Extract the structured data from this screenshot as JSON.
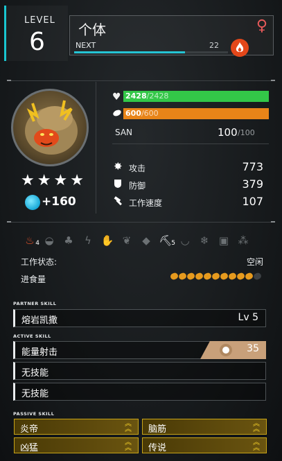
{
  "header": {
    "level_label": "LEVEL",
    "level_value": "6",
    "name": "个体",
    "gender_symbol": "♀",
    "next_label": "NEXT",
    "next_value": "22",
    "xp_progress_percent": 72,
    "element_icon": "fire-icon"
  },
  "stats": {
    "hp_current": "2428",
    "hp_max": "/2428",
    "hp_color": "#33c748",
    "hunger_current": "600",
    "hunger_max": "/600",
    "hunger_color": "#e88418",
    "san_label": "SAN",
    "san_value": "100",
    "san_max": "/100",
    "attack_label": "攻击",
    "attack_value": "773",
    "defense_label": "防御",
    "defense_value": "379",
    "work_speed_label": "工作速度",
    "work_speed_value": "107"
  },
  "portrait": {
    "stars": 4,
    "food_value": "+160"
  },
  "work": {
    "icons": [
      {
        "name": "kindling",
        "level": "4",
        "active": true
      },
      {
        "name": "watering",
        "level": "",
        "active": false
      },
      {
        "name": "planting",
        "level": "",
        "active": false
      },
      {
        "name": "electricity",
        "level": "",
        "active": false
      },
      {
        "name": "handiwork",
        "level": "",
        "active": false
      },
      {
        "name": "gathering",
        "level": "",
        "active": false
      },
      {
        "name": "lumbering",
        "level": "",
        "active": false
      },
      {
        "name": "mining",
        "level": "5",
        "active": true
      },
      {
        "name": "medicine",
        "level": "",
        "active": false
      },
      {
        "name": "cooling",
        "level": "",
        "active": false
      },
      {
        "name": "transporting",
        "level": "",
        "active": false
      },
      {
        "name": "farming",
        "level": "",
        "active": false
      }
    ],
    "status_label": "工作状态:",
    "status_value": "空闲",
    "food_label": "进食量",
    "food_filled": 10,
    "food_total": 11
  },
  "skills": {
    "partner_label": "PARTNER SKILL",
    "partner_name": "熔岩凯撒",
    "partner_level": "Lv 5",
    "active_label": "ACTIVE SKILL",
    "active": [
      {
        "name": "能量射击",
        "power": "35"
      },
      {
        "name": "无技能",
        "power": ""
      },
      {
        "name": "无技能",
        "power": ""
      }
    ],
    "passive_label": "PASSIVE SKILL",
    "passive": [
      "炎帝",
      "脑筋",
      "凶猛",
      "传说"
    ]
  }
}
